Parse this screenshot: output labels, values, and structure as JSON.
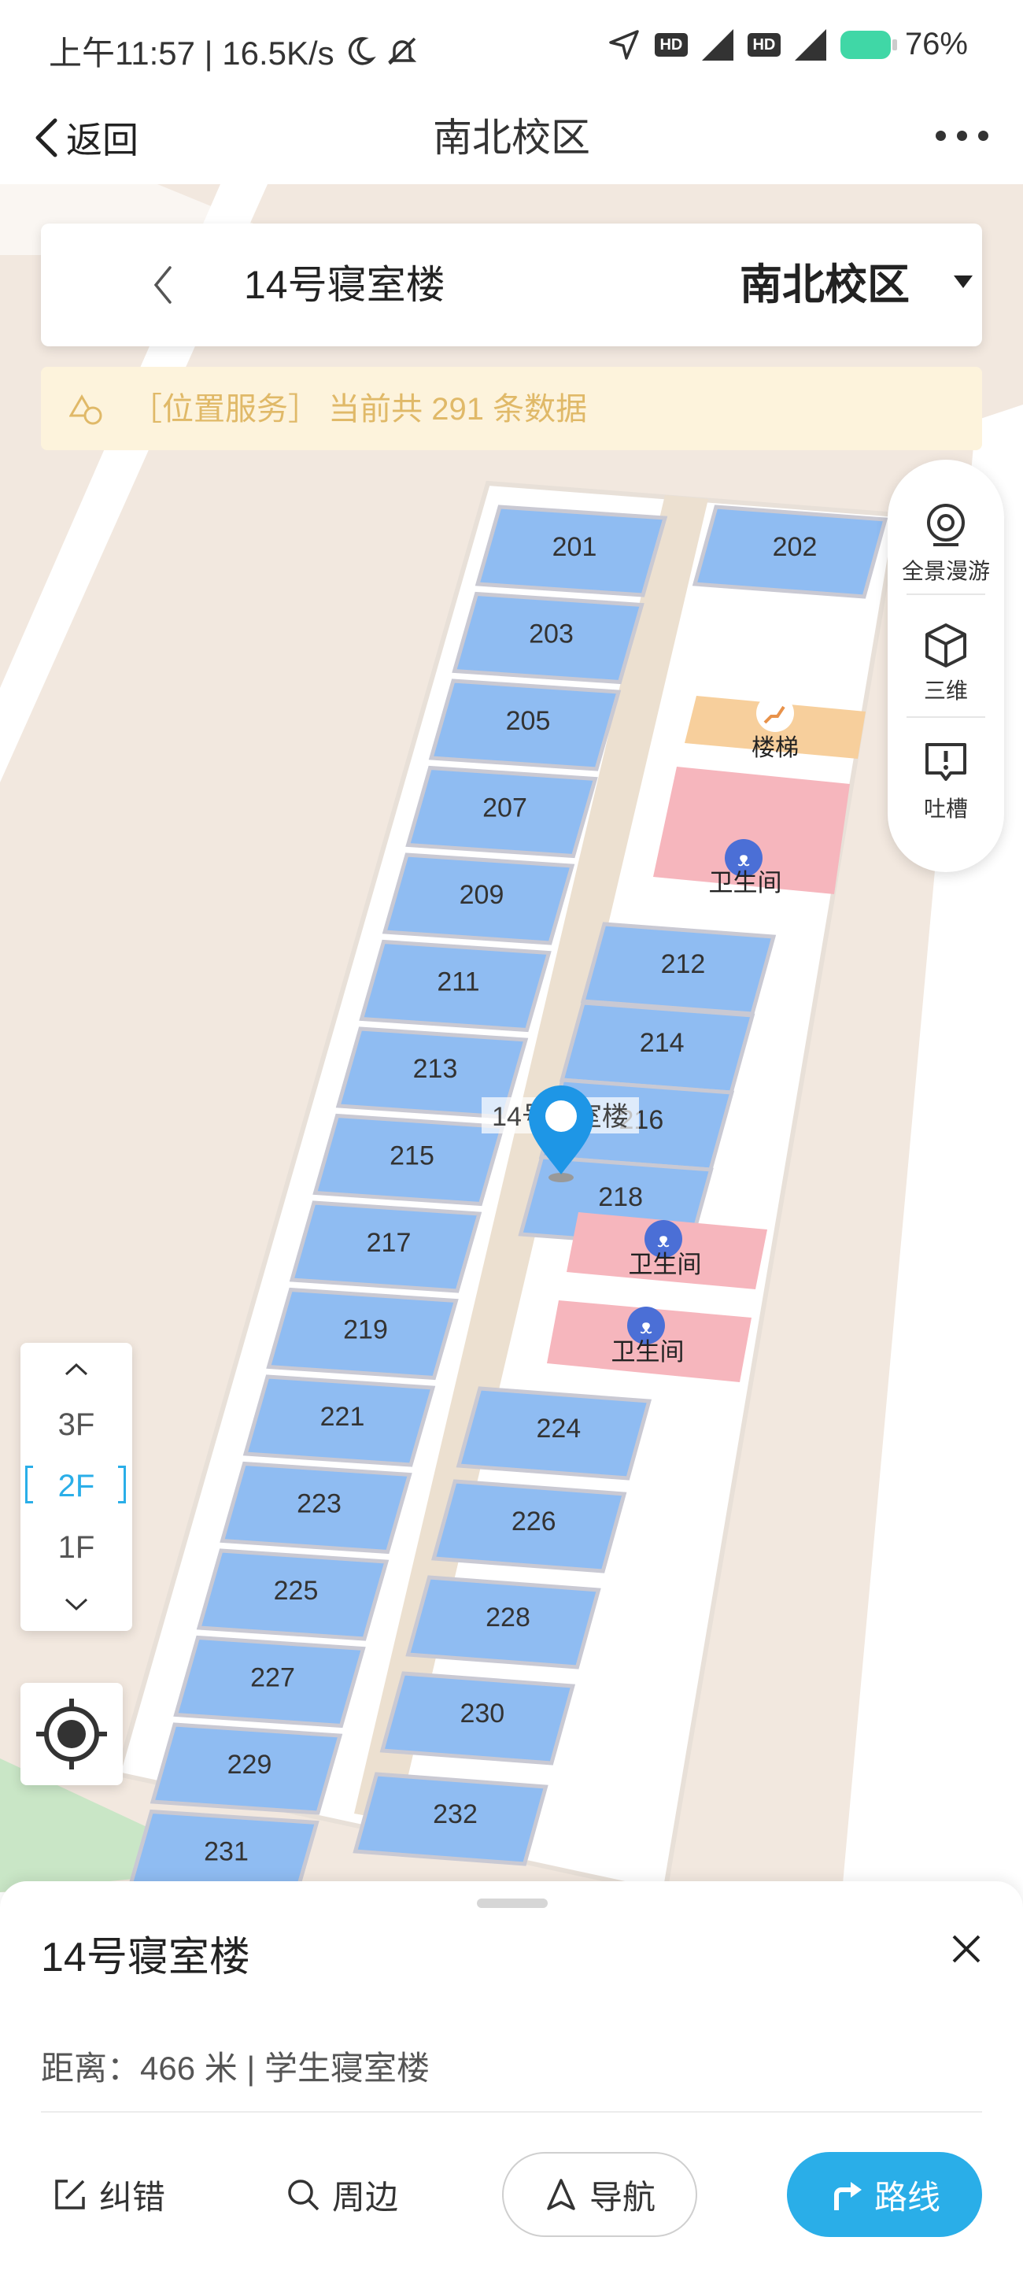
{
  "status_bar": {
    "time_speed": "上午11:57 | 16.5K/s",
    "battery": "76%"
  },
  "nav": {
    "back_label": "返回",
    "title": "南北校区"
  },
  "search": {
    "building": "14号寝室楼",
    "campus": "南北校区"
  },
  "notice": {
    "text": "［位置服务］ 当前共 291 条数据"
  },
  "toolbar": {
    "panorama": "全景漫游",
    "three_d": "三维",
    "feedback": "吐槽"
  },
  "map": {
    "rooms_left": [
      "201",
      "203",
      "205",
      "207",
      "209",
      "211",
      "213",
      "215",
      "217",
      "219",
      "221",
      "223",
      "225",
      "227",
      "229",
      "231"
    ],
    "rooms_right": [
      "202",
      "212",
      "214",
      "216",
      "218",
      "224",
      "226",
      "228",
      "230",
      "232"
    ],
    "stairs_label": "楼梯",
    "restroom_label": "卫生间",
    "building_label": "14号寝室楼",
    "colors": {
      "room": "#8fbcf2",
      "restroom": "#f6b6bd",
      "stairs": "#f7cf9c",
      "corridor": "#ece0d0",
      "ground": "#f2e8df",
      "road": "#ffffff",
      "accent": "#2aaee8"
    }
  },
  "floors": {
    "items": [
      "3F",
      "2F",
      "1F"
    ],
    "active": "2F"
  },
  "sheet": {
    "title": "14号寝室楼",
    "info": "距离：466 米 | 学生寝室楼",
    "actions": {
      "correct": "纠错",
      "nearby": "周边",
      "navigate": "导航",
      "route": "路线"
    }
  }
}
